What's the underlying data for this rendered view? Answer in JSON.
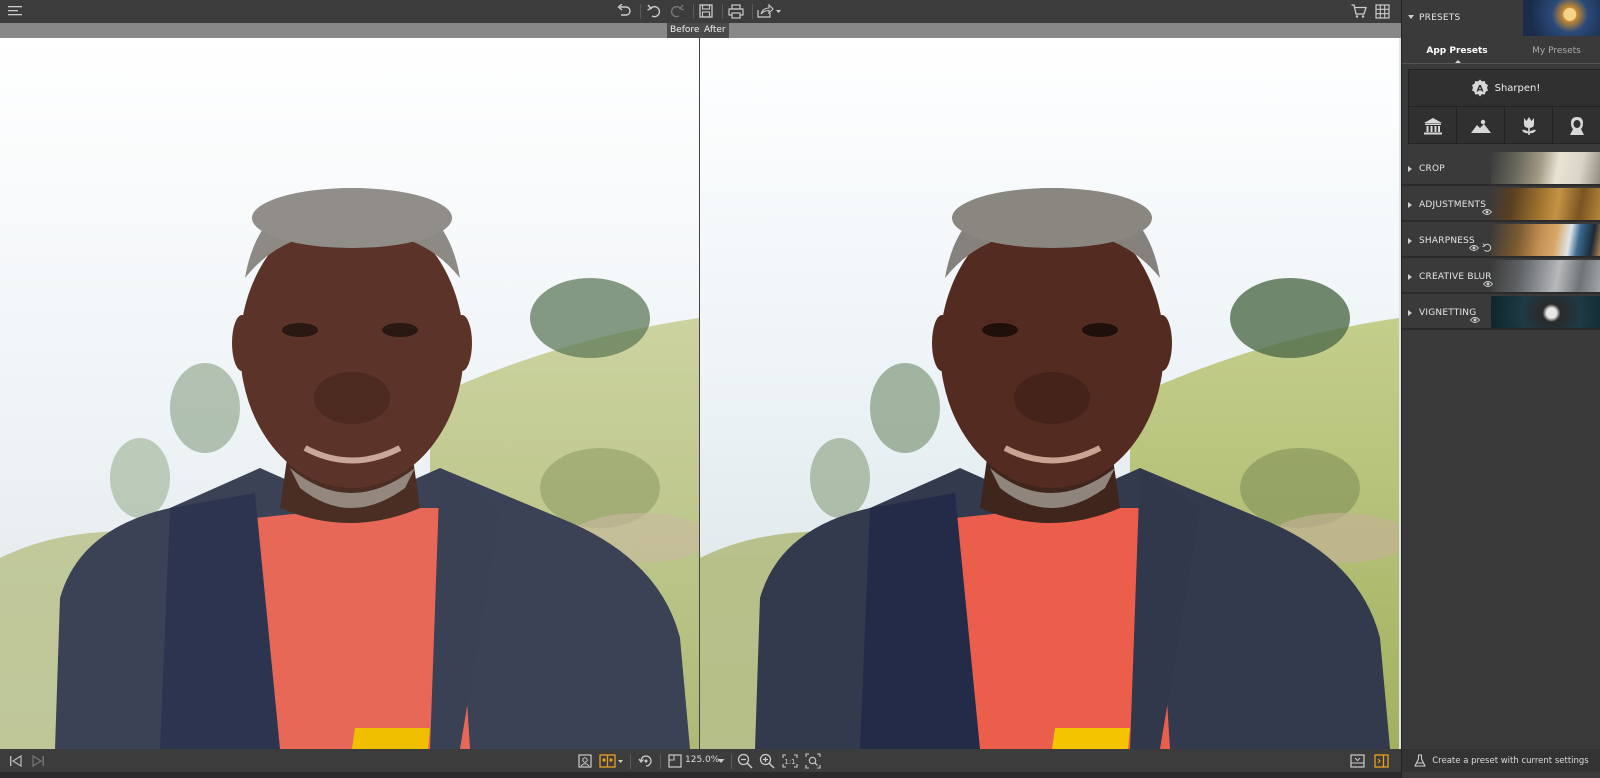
{
  "toolbar": {
    "menu_icon": "hamburger-icon",
    "undo_all_icon": "undo-all-icon",
    "undo_icon": "undo-icon",
    "redo_icon": "redo-icon",
    "save_icon": "save-icon",
    "print_icon": "print-icon",
    "share_icon": "share-icon",
    "cart_icon": "cart-icon",
    "grid_icon": "grid-icon"
  },
  "compare": {
    "before_label": "Before",
    "after_label": "After"
  },
  "bottom": {
    "zoom_value": "125.0%",
    "create_preset_label": "Create a preset with current settings"
  },
  "panel": {
    "presets_title": "PRESETS",
    "tabs": [
      {
        "label": "App Presets",
        "active": true
      },
      {
        "label": "My Presets",
        "active": false
      }
    ],
    "sharpen_label": "Sharpen!",
    "preset_categories": [
      "architecture-icon",
      "landscape-icon",
      "flower-icon",
      "portrait-icon"
    ],
    "sections": [
      {
        "label": "CROP"
      },
      {
        "label": "ADJUSTMENTS"
      },
      {
        "label": "SHARPNESS"
      },
      {
        "label": "CREATIVE BLUR"
      },
      {
        "label": "VIGNETTING"
      }
    ]
  },
  "colors": {
    "accent": "#e8a020",
    "panel_bg": "#3a3a3a",
    "toolbar_bg": "#3c3c3c"
  }
}
